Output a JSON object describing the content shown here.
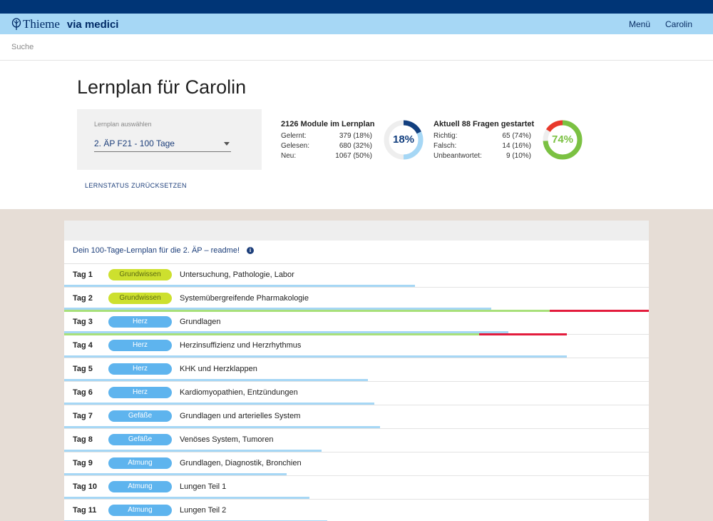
{
  "header": {
    "brand": "Thieme",
    "product": "via medici",
    "menu_label": "Menü",
    "user_label": "Carolin"
  },
  "search": {
    "label": "Suche"
  },
  "dashboard": {
    "title": "Lernplan für Carolin",
    "select_label": "Lernplan auswählen",
    "select_value": "2. ÄP F21 - 100 Tage",
    "reset_label": "LERNSTATUS ZURÜCKSETZEN",
    "modules": {
      "heading": "2126 Module im Lernplan",
      "rows": [
        {
          "label": "Gelernt:",
          "value": "379 (18%)"
        },
        {
          "label": "Gelesen:",
          "value": "680 (32%)"
        },
        {
          "label": "Neu:",
          "value": "1067 (50%)"
        }
      ],
      "donut_label": "18%",
      "donut_fractions": {
        "learned": 0.18,
        "read": 0.32,
        "new": 0.5
      }
    },
    "questions": {
      "heading": "Aktuell 88 Fragen gestartet",
      "rows": [
        {
          "label": "Richtig:",
          "value": "65 (74%)"
        },
        {
          "label": "Falsch:",
          "value": "14 (16%)"
        },
        {
          "label": "Unbeantwortet:",
          "value": "9 (10%)"
        }
      ],
      "donut_label": "74%",
      "donut_fractions": {
        "correct": 0.74,
        "wrong": 0.16,
        "unanswered": 0.1
      }
    }
  },
  "plan": {
    "intro": "Dein 100-Tage-Lernplan für die 2. ÄP – readme!",
    "days": [
      {
        "day": "Tag 1",
        "tag": "Grundwissen",
        "tag_color": "green",
        "topic": "Untersuchung, Pathologie, Labor",
        "read_progress": 0.6,
        "quiz": null
      },
      {
        "day": "Tag 2",
        "tag": "Grundwissen",
        "tag_color": "green",
        "topic": "Systemübergreifende Pharmakologie",
        "read_progress": 0.73,
        "quiz": {
          "correct": 0.83,
          "total": 1.0
        }
      },
      {
        "day": "Tag 3",
        "tag": "Herz",
        "tag_color": "blue",
        "topic": "Grundlagen",
        "read_progress": 0.76,
        "quiz": {
          "correct": 0.71,
          "total": 0.86
        }
      },
      {
        "day": "Tag 4",
        "tag": "Herz",
        "tag_color": "blue",
        "topic": "Herzinsuffizienz und Herzrhythmus",
        "read_progress": 0.86,
        "quiz": null
      },
      {
        "day": "Tag 5",
        "tag": "Herz",
        "tag_color": "blue",
        "topic": "KHK und Herzklappen",
        "read_progress": 0.52,
        "quiz": null
      },
      {
        "day": "Tag 6",
        "tag": "Herz",
        "tag_color": "blue",
        "topic": "Kardiomyopathien, Entzündungen",
        "read_progress": 0.53,
        "quiz": null
      },
      {
        "day": "Tag 7",
        "tag": "Gefäße",
        "tag_color": "blue",
        "topic": "Grundlagen und arterielles System",
        "read_progress": 0.54,
        "quiz": null
      },
      {
        "day": "Tag 8",
        "tag": "Gefäße",
        "tag_color": "blue",
        "topic": "Venöses System, Tumoren",
        "read_progress": 0.44,
        "quiz": null
      },
      {
        "day": "Tag 9",
        "tag": "Atmung",
        "tag_color": "blue",
        "topic": "Grundlagen, Diagnostik, Bronchien",
        "read_progress": 0.38,
        "quiz": null
      },
      {
        "day": "Tag 10",
        "tag": "Atmung",
        "tag_color": "blue",
        "topic": "Lungen Teil 1",
        "read_progress": 0.42,
        "quiz": null
      },
      {
        "day": "Tag 11",
        "tag": "Atmung",
        "tag_color": "blue",
        "topic": "Lungen Teil 2",
        "read_progress": 0.45,
        "quiz": null
      }
    ]
  },
  "colors": {
    "navy": "#003576",
    "header_blue": "#a6d7f5",
    "tag_green": "#cde02e",
    "tag_blue": "#5eb4ee",
    "bar_blue": "#a6d7f5",
    "bar_green": "#a8e07a",
    "bar_red": "#e31c3d",
    "donut_learned": "#123f7f",
    "donut_read": "#a6d7f5",
    "donut_new": "#eeeeee",
    "donut_correct": "#7bc142",
    "donut_wrong": "#e8392c",
    "donut_unanswered": "#eeeeee"
  }
}
